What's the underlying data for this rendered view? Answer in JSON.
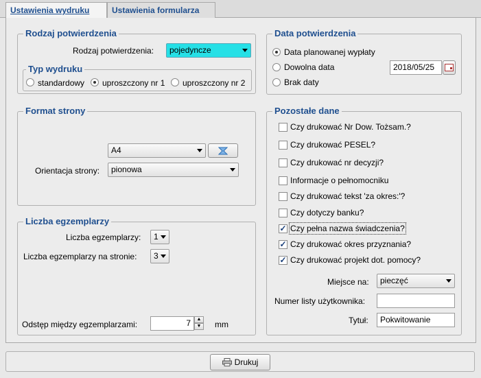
{
  "tabs": [
    {
      "label": "Ustawienia wydruku"
    },
    {
      "label": "Ustawienia formularza"
    }
  ],
  "rodzaj_group": {
    "title": "Rodzaj potwierdzenia",
    "field_label": "Rodzaj potwierdzenia:",
    "value": "pojedyncze",
    "typ_title": "Typ wydruku",
    "radios": [
      "standardowy",
      "uproszczony nr 1",
      "uproszczony nr 2"
    ]
  },
  "data_group": {
    "title": "Data potwierdzenia",
    "radios": [
      "Data planowanej wypłaty",
      "Dowolna data",
      "Brak daty"
    ],
    "date_value": "2018/05/25"
  },
  "format_group": {
    "title": "Format strony",
    "format_value": "A4",
    "orient_label": "Orientacja strony:",
    "orient_value": "pionowa"
  },
  "liczba_group": {
    "title": "Liczba egzemplarzy",
    "count_label": "Liczba egzemplarzy:",
    "count_value": "1",
    "per_page_label": "Liczba egzemplarzy na stronie:",
    "per_page_value": "3",
    "spacing_label": "Odstęp między egzemplarzami:",
    "spacing_value": "7",
    "spacing_unit": "mm"
  },
  "pozostale_group": {
    "title": "Pozostałe dane",
    "checks": [
      {
        "label": "Czy drukować Nr Dow. Tożsam.?",
        "checked": false
      },
      {
        "label": "Czy drukować PESEL?",
        "checked": false
      },
      {
        "label": "Czy drukować nr decyzji?",
        "checked": false
      },
      {
        "label": "Informacje o pełnomocniku",
        "checked": false
      },
      {
        "label": "Czy drukować tekst 'za okres:'?",
        "checked": false
      },
      {
        "label": "Czy dotyczy banku?",
        "checked": false
      },
      {
        "label": "Czy pełna nazwa świadczenia?",
        "checked": true
      },
      {
        "label": "Czy drukować okres przyznania?",
        "checked": true
      },
      {
        "label": "Czy drukować projekt dot. pomocy?",
        "checked": true
      }
    ],
    "miejsce_label": "Miejsce na:",
    "miejsce_value": "pieczęć",
    "numer_label": "Numer listy użytkownika:",
    "numer_value": "",
    "tytul_label": "Tytuł:",
    "tytul_value": "Pokwitowanie"
  },
  "print_button": {
    "label": "Drukuj"
  }
}
